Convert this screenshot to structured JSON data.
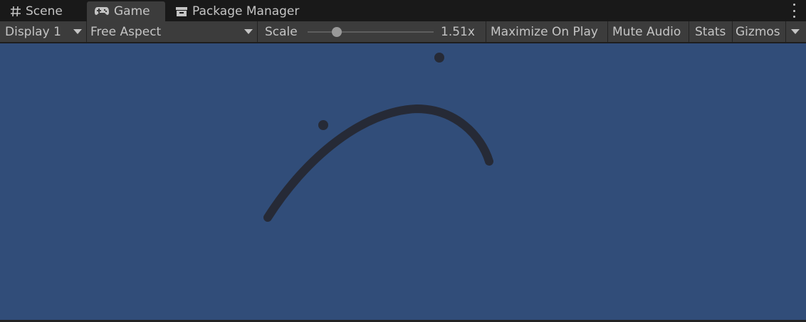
{
  "tabs": [
    {
      "label": "Scene",
      "icon": "grid-hash-icon",
      "active": false
    },
    {
      "label": "Game",
      "icon": "gamepad-icon",
      "active": true
    },
    {
      "label": "Package Manager",
      "icon": "package-box-icon",
      "active": false
    }
  ],
  "toolbar": {
    "display": "Display 1",
    "aspect": "Free Aspect",
    "scale_label": "Scale",
    "scale_value": "1.51x",
    "maximize": "Maximize On Play",
    "mute": "Mute Audio",
    "stats": "Stats",
    "gizmos": "Gizmos"
  },
  "colors": {
    "viewport_background": "#314d79",
    "stroke": "#262a36",
    "panel": "#3c3c3c"
  }
}
